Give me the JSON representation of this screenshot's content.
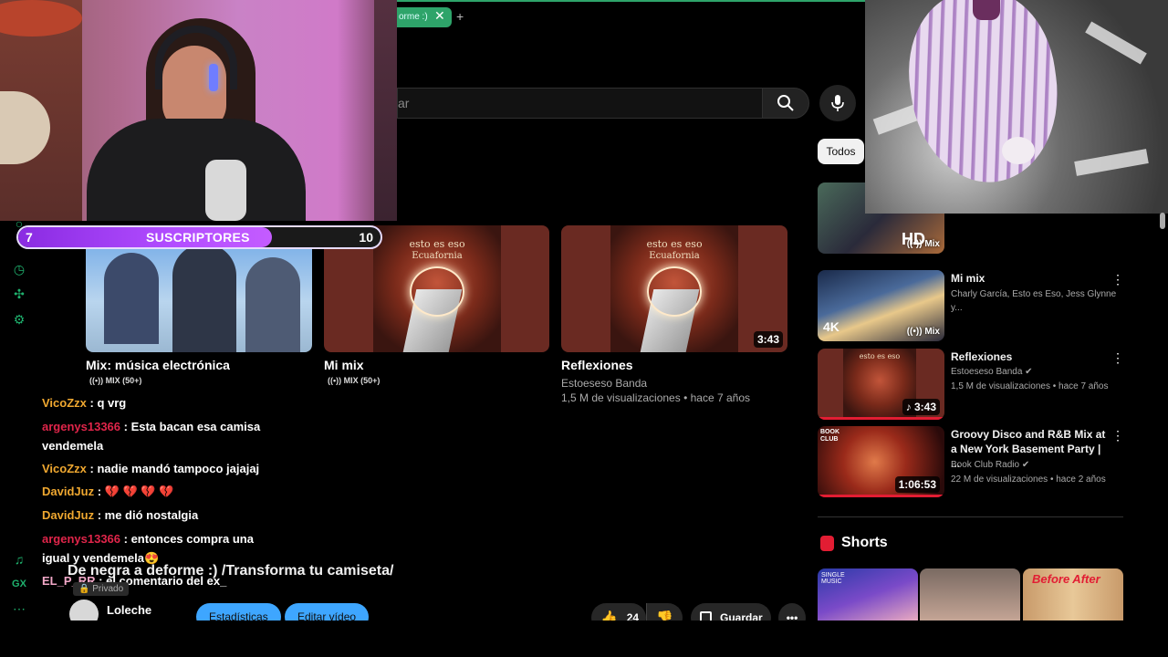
{
  "browser": {
    "tab_label": "orme :)",
    "tab_close": "✕",
    "new_tab": "+"
  },
  "search": {
    "placeholder_fragment": "ar"
  },
  "subscriber_goal": {
    "label": "SUSCRIPTORES",
    "current": "7",
    "goal": "10",
    "progress": 0.7
  },
  "endscreen": {
    "cards": [
      {
        "title": "Mix: música electrónica",
        "sub": "MIX (50+)"
      },
      {
        "title": "Mi mix",
        "sub": "MIX (50+)",
        "art_text": "esto es eso",
        "art_sub": "Ecuafornia"
      },
      {
        "title": "Reflexiones",
        "channel": "Estoeseso Banda",
        "meta": "1,5 M de visualizaciones • hace 7 años",
        "duration": "3:43",
        "art_text": "esto es eso",
        "art_sub": "Ecuafornia"
      }
    ]
  },
  "chat": [
    {
      "user": "VicoZzx",
      "color": "orange",
      "text": ": q vrg"
    },
    {
      "user": "argenys13366",
      "color": "red",
      "text": ": Esta bacan esa camisa"
    },
    {
      "user": "",
      "color": "",
      "text": "vendemela"
    },
    {
      "user": "VicoZzx",
      "color": "orange",
      "text": ": nadie mandó tampoco jajajaj"
    },
    {
      "user": "DavidJuz",
      "color": "orange",
      "text": ": 💔 💔 💔 💔"
    },
    {
      "user": "DavidJuz",
      "color": "orange",
      "text": ": me dió nostalgia"
    },
    {
      "user": "argenys13366",
      "color": "red",
      "text": ": entonces compra una"
    },
    {
      "user": "",
      "color": "",
      "text": "igual y vendemela😍"
    },
    {
      "user": "EL_P_RR",
      "color": "pink",
      "text": ": el comentario del ex_"
    }
  ],
  "video": {
    "title": "De negra a deforme :) /Transforma tu camiseta/",
    "privacy": "Privado",
    "channel": "Loleche",
    "stats_button": "Estadísticas",
    "edit_button": "Editar vídeo",
    "likes": "24",
    "save_button": "Guardar"
  },
  "sidebar": {
    "chip": "Todos",
    "items": [
      {
        "title": "",
        "meta": "",
        "tag": "Mix",
        "badge": "HD"
      },
      {
        "title": "Mi mix",
        "meta": "Charly García, Esto es Eso, Jess Glynne y...",
        "tag": "Mix",
        "badge": "4K"
      },
      {
        "title": "Reflexiones",
        "channel": "Estoeseso Banda",
        "meta": "1,5 M de visualizaciones • hace 7 años",
        "duration": "3:43"
      },
      {
        "title": "Groovy Disco and R&B Mix at a New York Basement Party | ...",
        "channel": "Book Club Radio",
        "meta": "22 M de visualizaciones • hace 2 años",
        "duration": "1:06:53",
        "thumb_text": "BOOK CLUB"
      }
    ],
    "shorts_title": "Shorts",
    "shorts": [
      {
        "caption": "SINGLE MUSIC"
      },
      {
        "caption": ""
      },
      {
        "caption": "Before After"
      }
    ]
  },
  "colors": {
    "accent_green": "#2ea46a",
    "youtube_red": "#e21d33",
    "blue_button": "#3ea6ff",
    "subscriber_purple": "#b14cff"
  },
  "icons": {
    "rail": [
      "history-icon",
      "puzzle-icon",
      "gear-icon",
      "music-icon",
      "gx-icon",
      "more-icon"
    ]
  }
}
